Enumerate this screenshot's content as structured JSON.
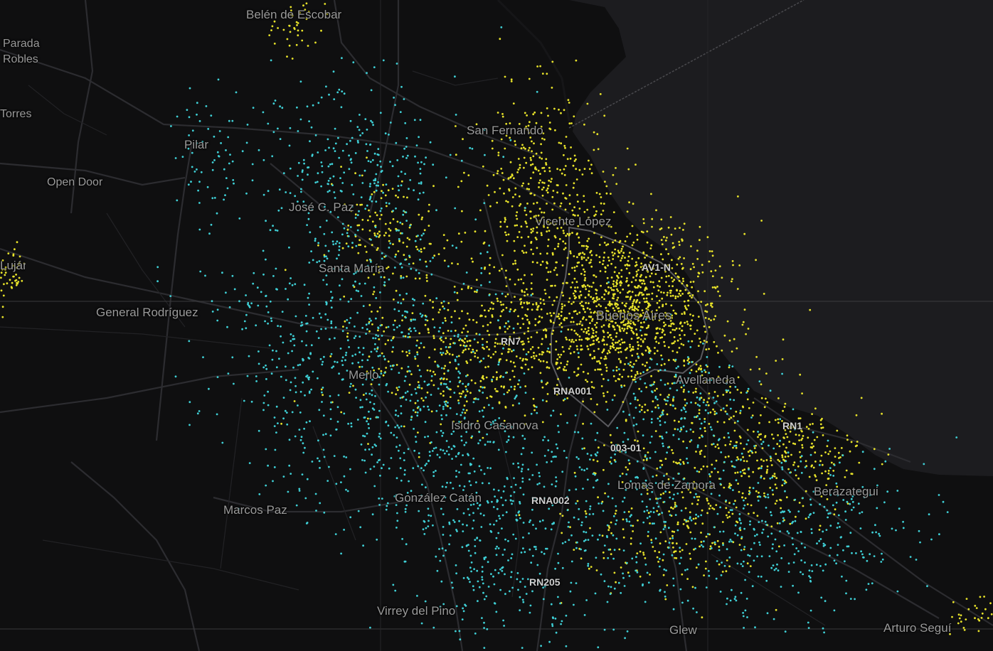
{
  "map": {
    "colors": {
      "land": "#0f0f10",
      "water": "#1c1c1f",
      "road": "#2b2b2e",
      "boundary": "#555558",
      "series_yellow": "#e8e32a",
      "series_cyan": "#3fd0d6"
    }
  },
  "places": {
    "belen_de_escobar": "Belén de Escobar",
    "parada_robles": "Parada\nRobles",
    "torres": "Torres",
    "pilar": "Pilar",
    "open_door": "Open Door",
    "jose_c_paz": "José C. Paz",
    "san_fernando": "San Fernando",
    "vicente_lopez": "Vicente López",
    "lujan": "Luján",
    "santa_maria": "Santa María",
    "general_rodriguez": "General Rodríguez",
    "buenos_aires": "Buenos Aires",
    "merlo": "Merlo",
    "avellaneda": "Avellaneda",
    "isidro_casanova": "Isidro Casanova",
    "gonzalez_catan": "González Catán",
    "lomas_de_zamora": "Lomas de Zamora",
    "marcos_paz": "Marcos Paz",
    "berazategui": "Berazategui",
    "virrey_del_pino": "Virrey del Pino",
    "glew": "Glew",
    "arturo_segui": "Arturo Seguí"
  },
  "routes": {
    "av1n": "AV1-N",
    "rn7": "RN7",
    "rna001": "RNA001",
    "rn1": "RN1",
    "r00301": "003-01",
    "rna002": "RNA002",
    "rn205": "RN205"
  }
}
